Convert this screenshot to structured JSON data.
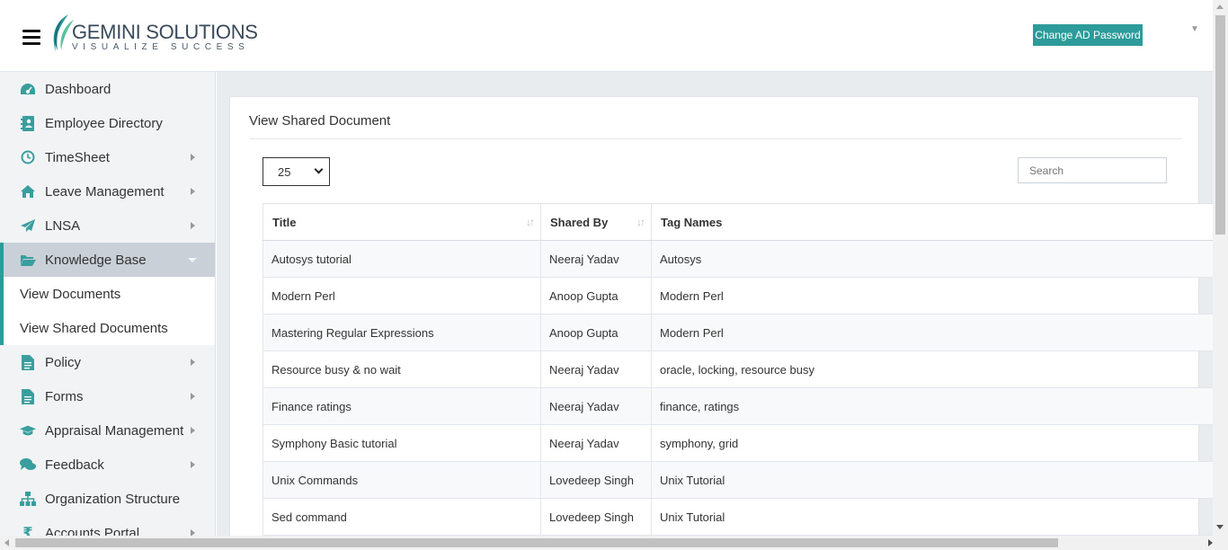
{
  "header": {
    "brand_name": "GEMINI SOLUTIONS",
    "brand_tagline": "VISUALIZE SUCCESS",
    "change_password_label": "Change AD Password"
  },
  "sidebar": {
    "items": [
      {
        "label": "Dashboard",
        "icon": "dashboard-icon"
      },
      {
        "label": "Employee Directory",
        "icon": "directory-icon"
      },
      {
        "label": "TimeSheet",
        "icon": "clock-icon"
      },
      {
        "label": "Leave Management",
        "icon": "home-icon"
      },
      {
        "label": "LNSA",
        "icon": "paper-plane-icon"
      },
      {
        "label": "Knowledge Base",
        "icon": "folder-open-icon"
      },
      {
        "label": "Policy",
        "icon": "file-icon"
      },
      {
        "label": "Forms",
        "icon": "file-text-icon"
      },
      {
        "label": "Appraisal Management",
        "icon": "graduation-cap-icon"
      },
      {
        "label": "Feedback",
        "icon": "comments-icon"
      },
      {
        "label": "Organization Structure",
        "icon": "sitemap-icon"
      },
      {
        "label": "Accounts Portal",
        "icon": "rupee-icon"
      }
    ],
    "sub_items": [
      {
        "label": "View Documents"
      },
      {
        "label": "View Shared Documents"
      }
    ]
  },
  "main": {
    "title": "View Shared Document",
    "page_size": "25",
    "search_placeholder": "Search",
    "columns": [
      "Title",
      "Shared By",
      "Tag Names"
    ],
    "rows": [
      [
        "Autosys tutorial",
        "Neeraj Yadav",
        "Autosys"
      ],
      [
        "Modern Perl",
        "Anoop Gupta",
        "Modern Perl"
      ],
      [
        "Mastering Regular Expressions",
        "Anoop Gupta",
        "Modern Perl"
      ],
      [
        "Resource busy & no wait",
        "Neeraj Yadav",
        "oracle, locking, resource busy"
      ],
      [
        "Finance ratings",
        "Neeraj Yadav",
        "finance, ratings"
      ],
      [
        "Symphony Basic tutorial",
        "Neeraj Yadav",
        "symphony, grid"
      ],
      [
        "Unix Commands",
        "Lovedeep Singh",
        "Unix Tutorial"
      ],
      [
        "Sed command",
        "Lovedeep Singh",
        "Unix Tutorial"
      ]
    ]
  },
  "colors": {
    "accent": "#2e9b9b",
    "icon": "#3a9e9e",
    "sidebar_bg": "#f2f3f5",
    "active_bg": "#c9d0d7"
  }
}
